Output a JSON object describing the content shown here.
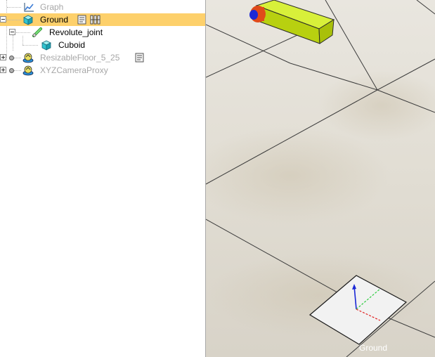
{
  "tree": {
    "items": [
      {
        "label": "Graph",
        "icon": "graph-icon"
      },
      {
        "label": "Ground",
        "icon": "cube-icon",
        "selected": true
      },
      {
        "label": "Revolute_joint",
        "icon": "joint-icon"
      },
      {
        "label": "Cuboid",
        "icon": "cube-icon"
      },
      {
        "label": "ResizableFloor_5_25",
        "icon": "model-icon"
      },
      {
        "label": "XYZCameraProxy",
        "icon": "model-icon"
      }
    ]
  },
  "viewport": {
    "object_label": "Ground"
  },
  "colors": {
    "selection": "#fdd06b",
    "dim_text": "#a7a7a7",
    "cuboid": "#c8e01a",
    "joint_red": "#e04a1a",
    "joint_blue": "#1b28d6"
  }
}
